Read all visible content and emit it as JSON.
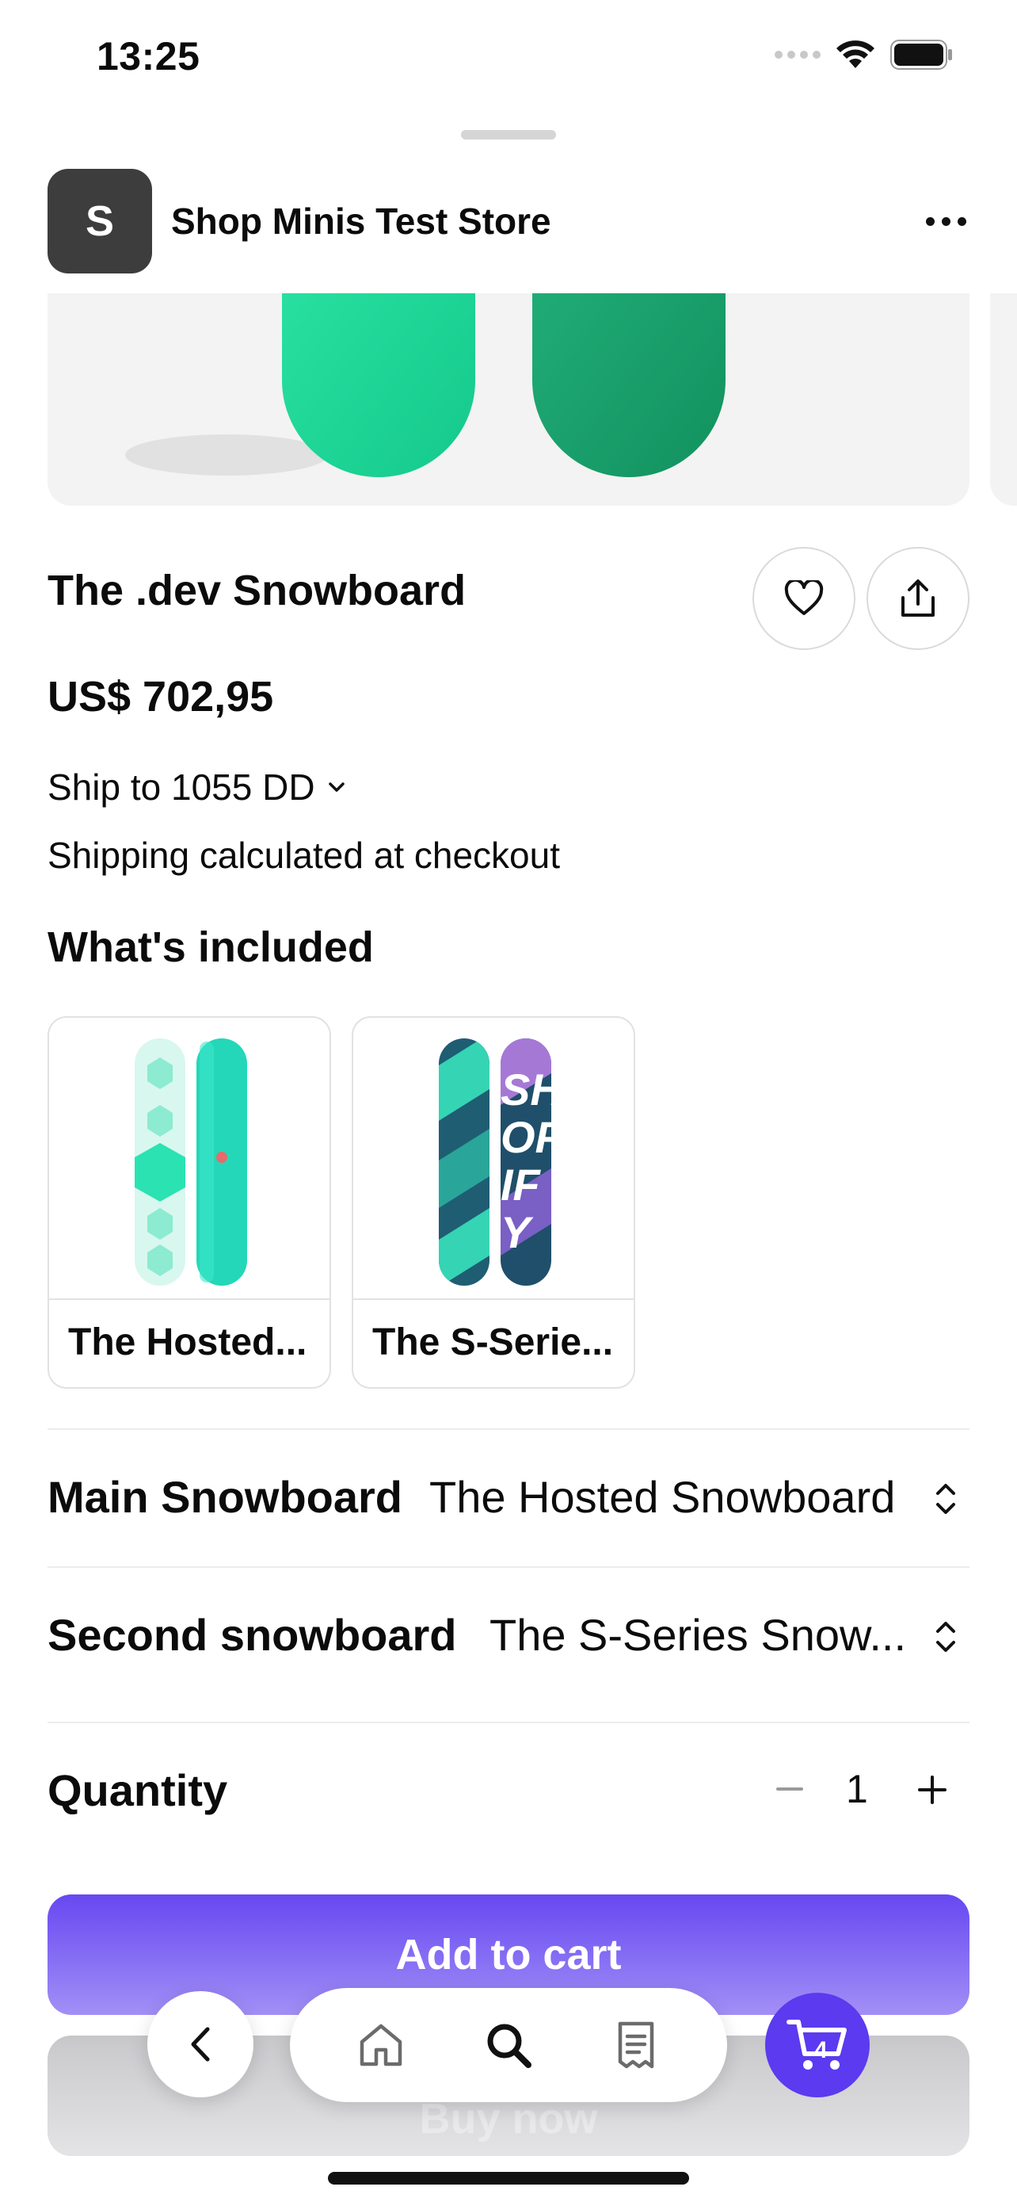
{
  "status_bar": {
    "time": "13:25"
  },
  "store": {
    "logo_letter": "S",
    "name": "Shop Minis Test Store"
  },
  "product": {
    "title": "The .dev Snowboard",
    "price": "US$ 702,95",
    "ship_to": "Ship to 1055 DD",
    "shipping_note": "Shipping calculated at checkout"
  },
  "included": {
    "heading": "What's included",
    "items": [
      {
        "label": "The Hosted..."
      },
      {
        "label": "The S-Serie..."
      }
    ]
  },
  "options": [
    {
      "label": "Main Snowboard",
      "value": "The Hosted Snowboard"
    },
    {
      "label": "Second snowboard",
      "value": "The S-Series Snow..."
    }
  ],
  "quantity": {
    "label": "Quantity",
    "value": "1",
    "minus": "–",
    "plus": "+"
  },
  "actions": {
    "add_to_cart": "Add to cart",
    "buy_now": "Buy now"
  },
  "cart": {
    "count": "4"
  },
  "colors": {
    "accent": "#5b3af0",
    "text": "#0b0b0b",
    "divider": "#ececec"
  }
}
